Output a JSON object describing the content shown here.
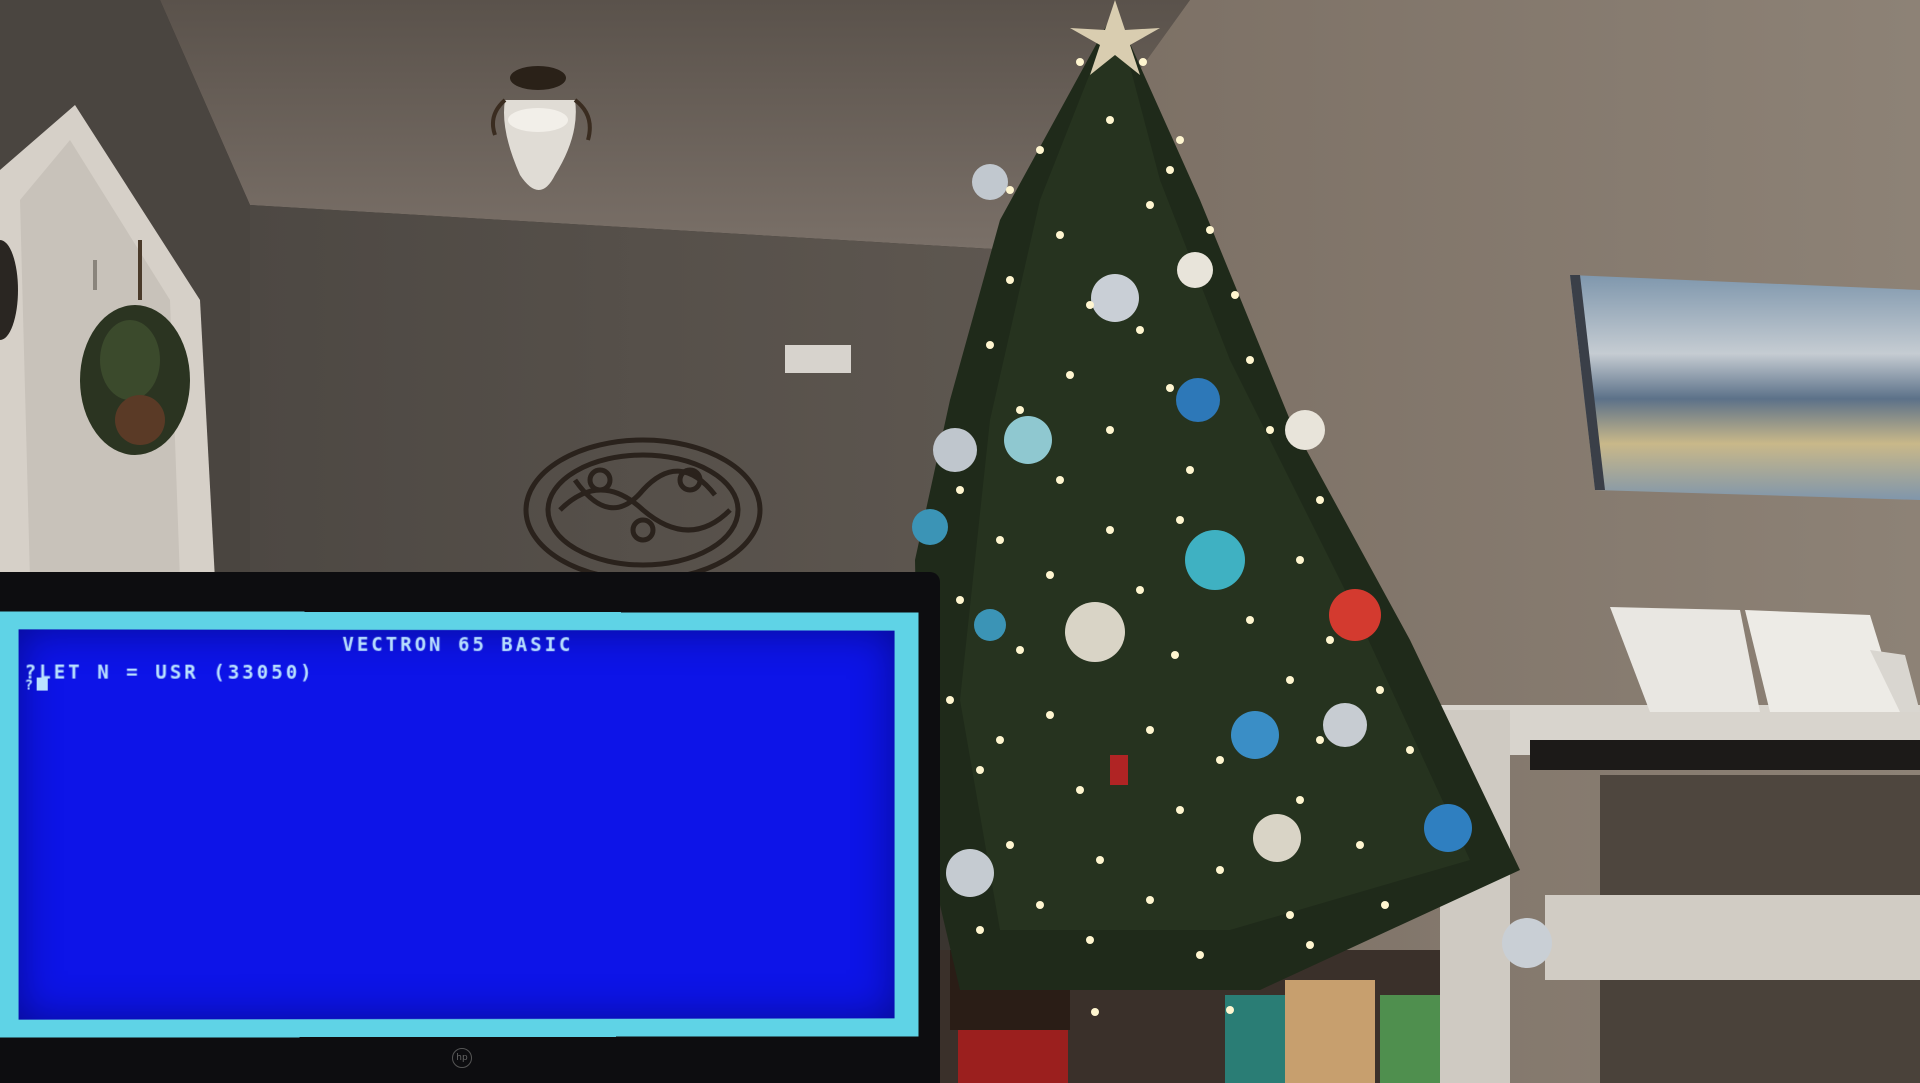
{
  "screen": {
    "title": "VECTRON 65 BASIC",
    "command_line": "?LET N = USR (33050)",
    "prompt": "?",
    "background_color": "#0d14e8",
    "border_color": "#5fd3e6",
    "text_color": "#b9e2ff"
  },
  "monitor": {
    "logo": "hp"
  },
  "scene": {
    "tree_light_color": "#fff6d0",
    "wall_color": "#6a625a"
  }
}
